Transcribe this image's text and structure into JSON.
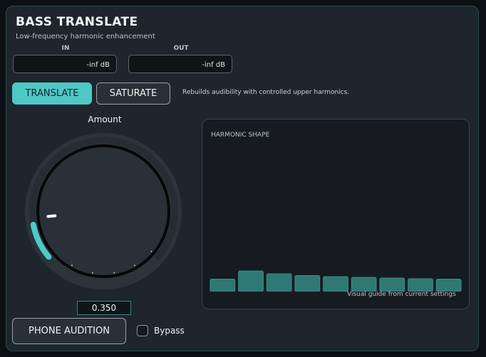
{
  "app": {
    "title": "BASS TRANSLATE",
    "subtitle": "Low-frequency harmonic enhancement"
  },
  "meters": {
    "in": {
      "label": "IN",
      "value": "-inf dB"
    },
    "out": {
      "label": "OUT",
      "value": "-inf dB"
    }
  },
  "modes": {
    "translate_label": "TRANSLATE",
    "saturate_label": "SATURATE",
    "selected": "TRANSLATE",
    "description": "Rebuilds audibility with controlled upper harmonics."
  },
  "amount": {
    "label": "Amount",
    "value_text": "0.350",
    "value": 0.35
  },
  "phone_audition": {
    "label": "PHONE AUDITION"
  },
  "bypass": {
    "label": "Bypass",
    "checked": false
  },
  "harmonic_shape": {
    "title": "HARMONIC SHAPE",
    "caption": "Visual guide from current settings",
    "levels": [
      0.35,
      0.58,
      0.5,
      0.45,
      0.42,
      0.4,
      0.38,
      0.36,
      0.35
    ]
  },
  "colors": {
    "accent": "#4fc8c8",
    "panel": "#1e252c",
    "bar": "#2f7874"
  }
}
